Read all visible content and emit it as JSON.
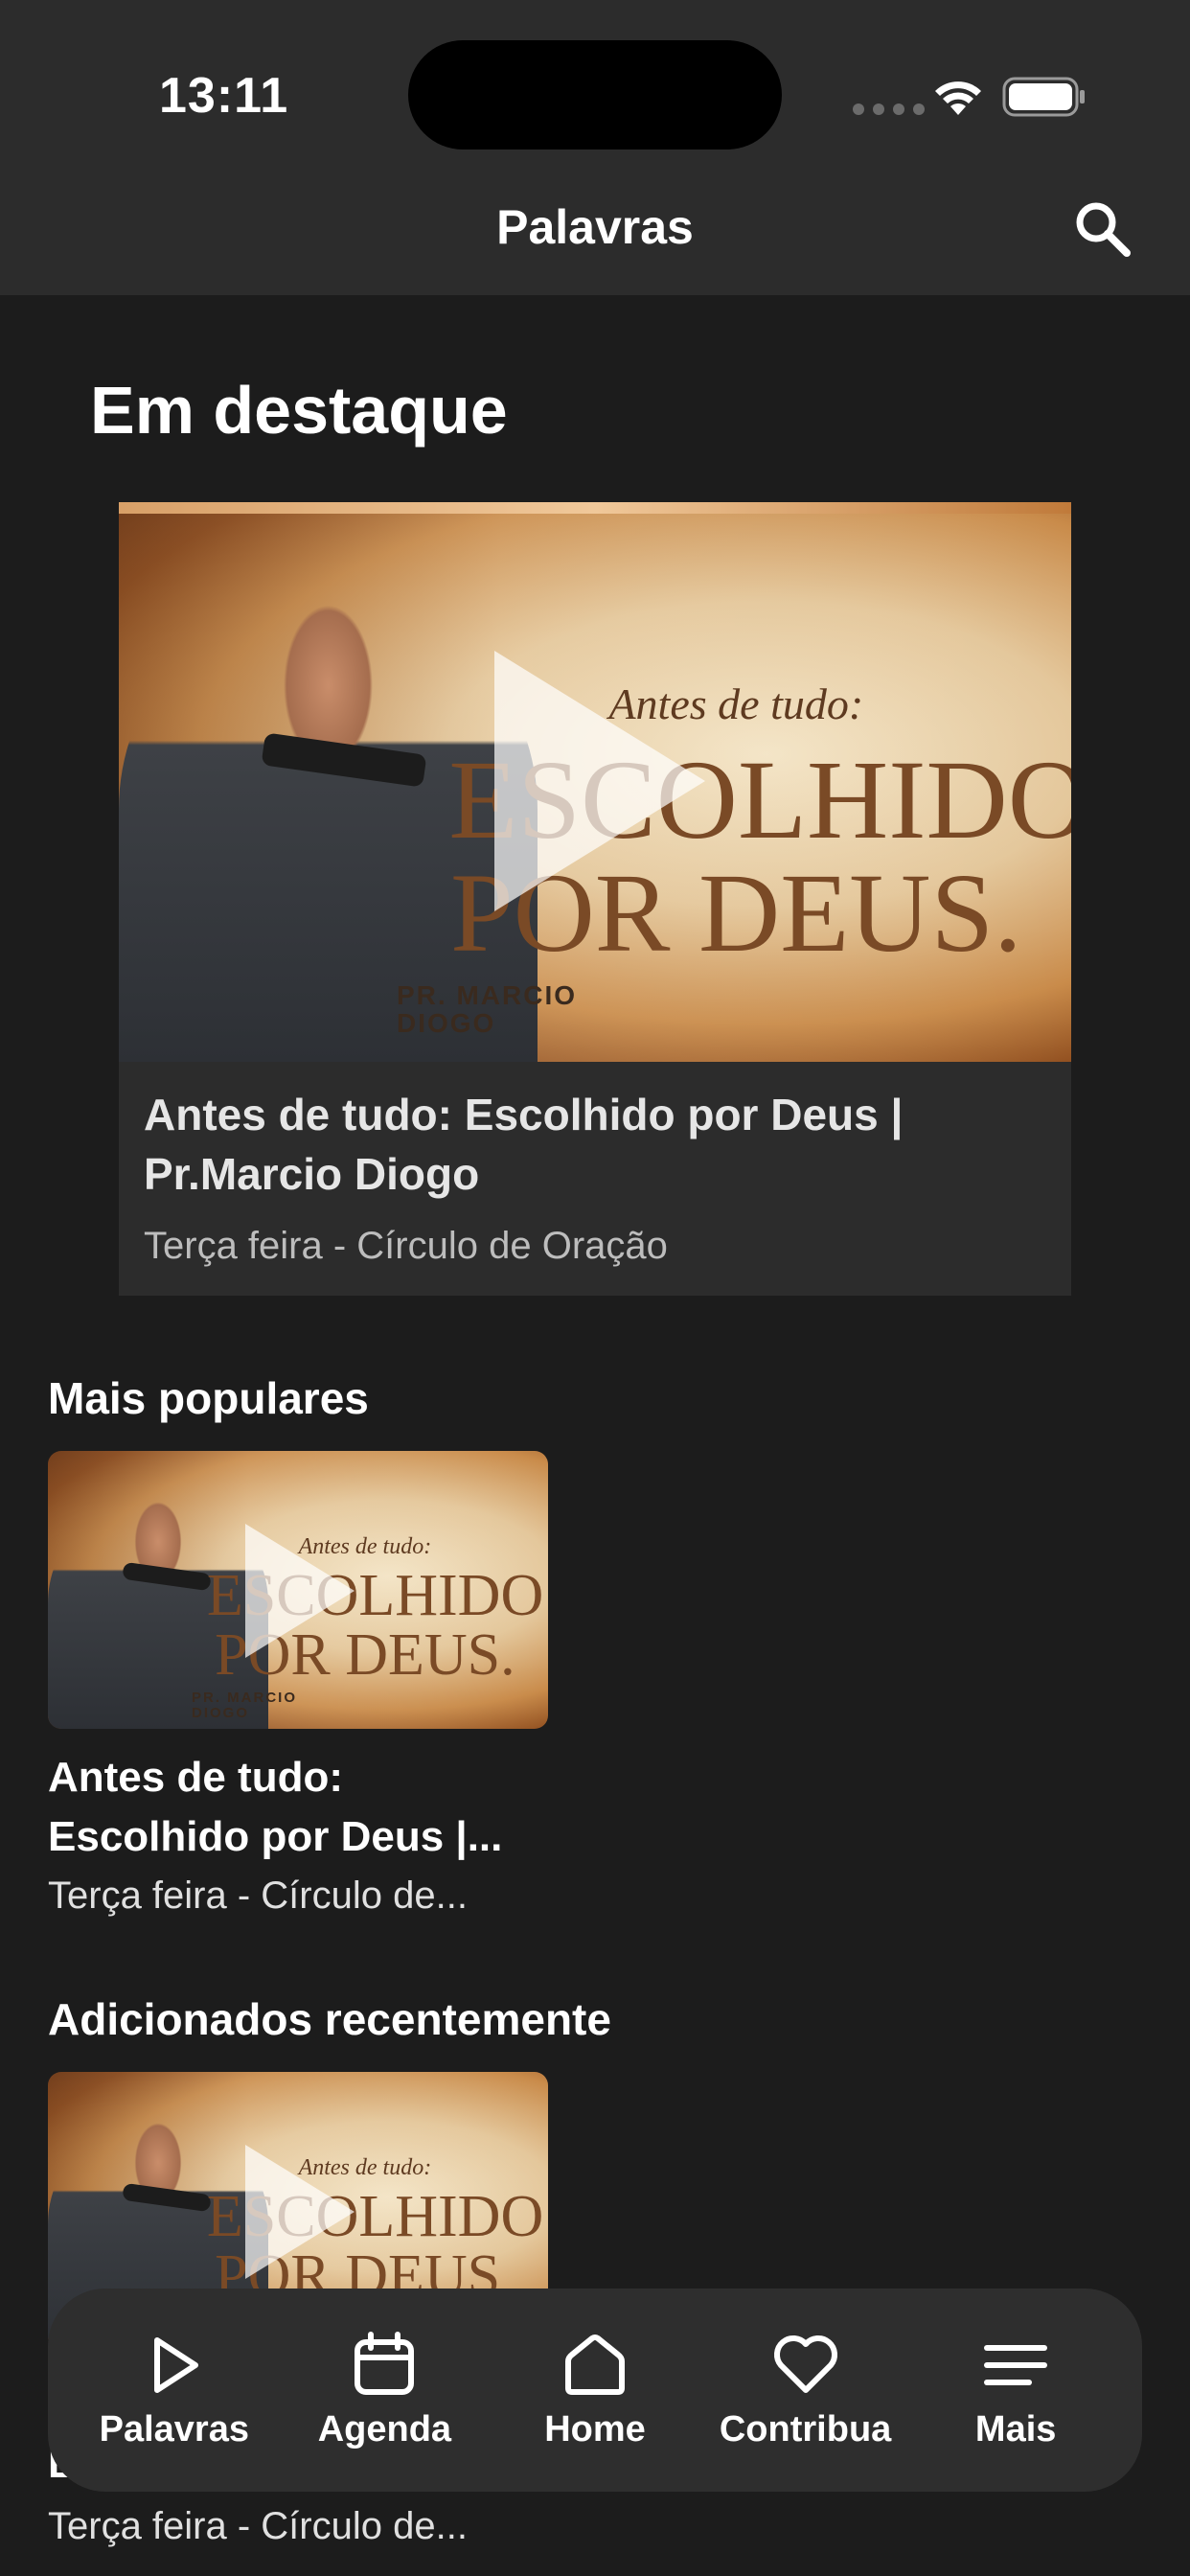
{
  "status_bar": {
    "time": "13:11"
  },
  "header": {
    "title": "Palavras",
    "search_icon": "search-icon"
  },
  "featured": {
    "section_title": "Em destaque",
    "video": {
      "title": "Antes de tudo: Escolhido por Deus | Pr.Marcio Diogo",
      "subtitle": "Terça feira - Círculo de Oração",
      "art": {
        "line1": "Antes de tudo:",
        "line2": "ESCOLHIDO",
        "line3": "POR DEUS.",
        "speaker1": "PR. MARCIO",
        "speaker2": "DIOGO"
      }
    }
  },
  "popular": {
    "section_title": "Mais populares",
    "items": [
      {
        "title": "Antes de tudo: Escolhido por Deus |...",
        "subtitle": "Terça feira - Círculo de..."
      }
    ]
  },
  "recent": {
    "section_title": "Adicionados recentemente",
    "items": [
      {
        "title": "E",
        "subtitle": "Terça feira - Círculo de..."
      }
    ]
  },
  "bottom_nav": [
    {
      "label": "Palavras",
      "icon": "play-icon"
    },
    {
      "label": "Agenda",
      "icon": "calendar-icon"
    },
    {
      "label": "Home",
      "icon": "home-icon"
    },
    {
      "label": "Contribua",
      "icon": "heart-icon"
    },
    {
      "label": "Mais",
      "icon": "menu-icon"
    }
  ],
  "colors": {
    "background": "#1c1c1c",
    "header": "#2c2c2c",
    "card": "#2c2c2c",
    "nav": "#2e2e2e"
  }
}
